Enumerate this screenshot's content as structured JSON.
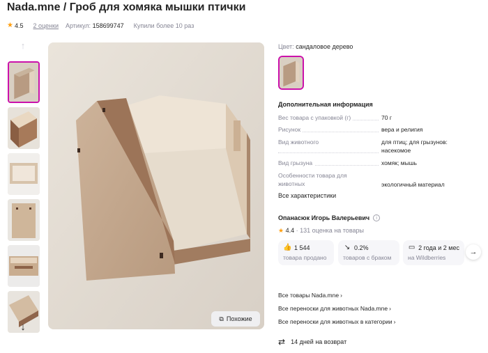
{
  "product": {
    "title": "Nada.mne / Гроб для хомяка мышки птички",
    "rating": "4.5",
    "reviews": "2 оценки",
    "article_label": "Артикул:",
    "article_value": "158699747",
    "purchases": "Купили более 10 раз"
  },
  "gallery": {
    "up_arrow_icon": "arrow-up-icon",
    "down_arrow_icon": "arrow-down-icon",
    "similar_label": "Похожие",
    "thumbnail_count": 6
  },
  "color": {
    "label": "Цвет:",
    "value": "сандаловое дерево",
    "selected_border": "#cb11ab"
  },
  "specs": {
    "title": "Дополнительная информация",
    "rows": [
      {
        "key": "Вес товара с упаковкой (г)",
        "value": "70 г"
      },
      {
        "key": "Рисунок",
        "value": "вера и религия"
      },
      {
        "key": "Вид животного",
        "value": "для птиц; для грызунов: насекомое"
      },
      {
        "key": "Вид грызуна",
        "value": "хомяк; мышь"
      },
      {
        "key": "Особенности товара для животных",
        "value": "экологичный материал"
      }
    ],
    "all_link": "Все характеристики"
  },
  "seller": {
    "name": "Опанасюк Игорь Валерьевич",
    "rating": "4.4",
    "rating_text": "· 131 оценка на товары",
    "stats": [
      {
        "icon": "thumbs-up-icon",
        "value": "1 544",
        "label": "товара продано"
      },
      {
        "icon": "trend-down-icon",
        "value": "0.2%",
        "label": "товаров с браком"
      },
      {
        "icon": "calendar-icon",
        "value": "2 года и 2 мес",
        "label": "на Wildberries"
      }
    ]
  },
  "links": [
    "Все товары Nada.mne",
    "Все переноски для животных Nada.mne",
    "Все переноски для животных в категории"
  ],
  "refund": {
    "text": "14 дней на возврат"
  },
  "colors": {
    "accent": "#cb11ab",
    "star": "#ff9e0d",
    "muted": "#868695"
  }
}
